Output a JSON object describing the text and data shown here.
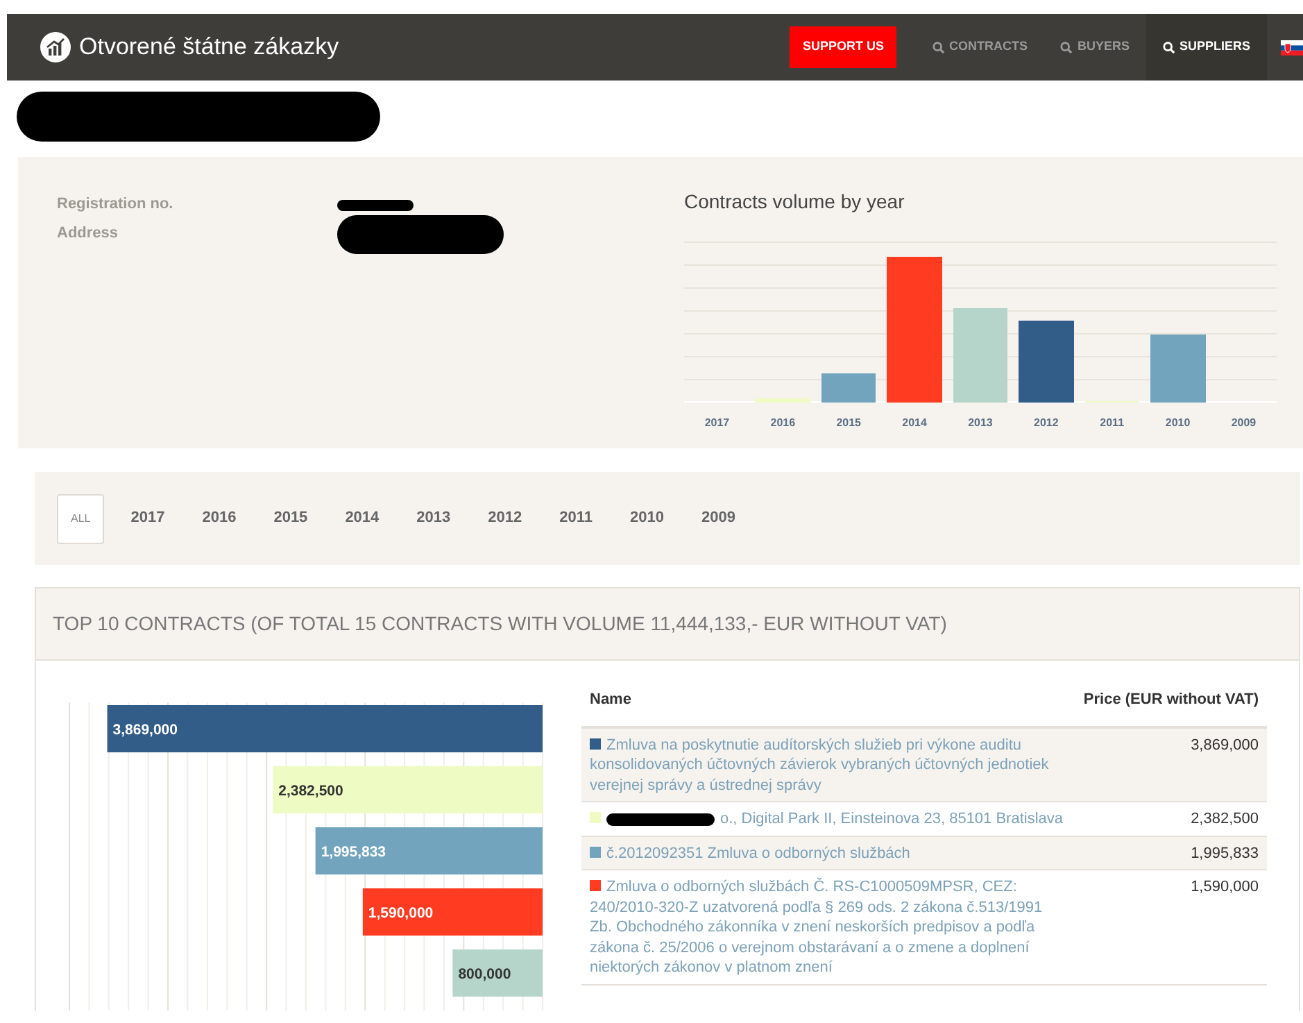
{
  "navbar": {
    "brand": "Otvorené štátne zákazky",
    "support_button": "SUPPORT US",
    "links": [
      {
        "label": "CONTRACTS",
        "selected": false
      },
      {
        "label": "BUYERS",
        "selected": false
      },
      {
        "label": "SUPPLIERS",
        "selected": true
      }
    ]
  },
  "heading": {
    "redacted": true
  },
  "details": {
    "fields": [
      {
        "label": "Registration no.",
        "redacted": true
      },
      {
        "label": "Address",
        "redacted": true
      }
    ]
  },
  "year_chart": {
    "title": "Contracts volume by year",
    "year_labels": [
      "2017",
      "2016",
      "2015",
      "2014",
      "2013",
      "2012",
      "2011",
      "2010",
      "2009"
    ]
  },
  "year_filter": [
    {
      "label": "ALL",
      "selected": true
    },
    {
      "label": "2017",
      "selected": false
    },
    {
      "label": "2016",
      "selected": false
    },
    {
      "label": "2015",
      "selected": false
    },
    {
      "label": "2014",
      "selected": false
    },
    {
      "label": "2013",
      "selected": false
    },
    {
      "label": "2012",
      "selected": false
    },
    {
      "label": "2011",
      "selected": false
    },
    {
      "label": "2010",
      "selected": false
    },
    {
      "label": "2009",
      "selected": false
    }
  ],
  "top_contracts": {
    "title": "TOP 10 CONTRACTS (OF TOTAL 15 CONTRACTS WITH VOLUME 11,444,133,- EUR WITHOUT VAT)",
    "bars": [
      {
        "label": "3,869,000",
        "level": 0.92,
        "color": "#325d88"
      },
      {
        "label": "2,382,500",
        "level": 0.57,
        "color": "#eefcc4"
      },
      {
        "label": "1,995,833",
        "level": 0.48,
        "color": "#73a4bd"
      },
      {
        "label": "1,590,000",
        "level": 0.38,
        "color": "#ff3b22"
      },
      {
        "label": "800,000",
        "level": 0.19,
        "color": "#b5d5cb"
      }
    ],
    "columns": [
      "Name",
      "Price (EUR without VAT)"
    ],
    "rows": [
      {
        "color": "#325d88",
        "name": "Zmluva na poskytnutie audítorských služieb pri výkone auditu konsolidovaných účtovných závierok vybraných účtovných jednotiek verejnej správy a ústrednej správy",
        "price": "3,869,000",
        "redacted": false
      },
      {
        "color": "#eefcc4",
        "name": "o., Digital Park II, Einsteinova 23, 85101 Bratislava",
        "price": "2,382,500",
        "redacted": true
      },
      {
        "color": "#73a4bd",
        "name": "č.2012092351 Zmluva o odborných službách",
        "price": "1,995,833",
        "redacted": false
      },
      {
        "color": "#ff3b22",
        "name": "Zmluva o odborných službách Č. RS-C1000509MPSR, CEZ: 240/2010-320-Z uzatvorená podľa § 269 ods. 2 zákona č.513/1991 Zb. Obchodného zákonníka v znení neskorších predpisov a podľa zákona č. 25/2006 o verejnom obstarávaní a o zmene a doplnení niektorých zákonov v platnom znení",
        "price": "1,590,000",
        "redacted": false
      }
    ]
  }
}
